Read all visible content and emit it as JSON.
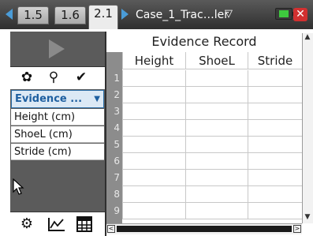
{
  "tabs": [
    {
      "label": "1.5",
      "active": false
    },
    {
      "label": "1.6",
      "active": false
    },
    {
      "label": "2.1",
      "active": true
    }
  ],
  "document": {
    "title": "Case_1_Trac…ler"
  },
  "icons": {
    "nav_left": "left-arrow-icon",
    "nav_right": "right-arrow-icon",
    "doc_menu": "chevron-down-icon",
    "battery": "battery-icon",
    "close": "close-icon",
    "play": "play-icon",
    "gear": "gear-icon",
    "pin": "pin-icon",
    "check": "check-icon",
    "meter": "meter-icon",
    "graph": "graph-icon",
    "table": "table-icon",
    "cursor": "cursor-icon"
  },
  "glyphs": {
    "gear": "✿",
    "pin": "⚲",
    "check": "✔",
    "meter": "⚙",
    "graph": "⦧",
    "table": "▦",
    "dropdown": "▼",
    "close": "✕",
    "chev": "▽",
    "up": "▲",
    "down": "▼",
    "left": "<",
    "right": ">"
  },
  "left_panel": {
    "selector": "Evidence ...",
    "columns": [
      "Height (cm)",
      "ShoeL (cm)",
      "Stride (cm)"
    ]
  },
  "sheet": {
    "title": "Evidence Record",
    "headers": [
      "Height",
      "ShoeL",
      "Stride"
    ],
    "row_numbers": [
      "1",
      "2",
      "3",
      "4",
      "5",
      "6",
      "7",
      "8",
      "9"
    ]
  },
  "colors": {
    "accent": "#4a9cd8",
    "battery": "#3ec93e",
    "close": "#d23030",
    "panel": "#5b5b5b",
    "selector_text": "#1e5fa0"
  }
}
